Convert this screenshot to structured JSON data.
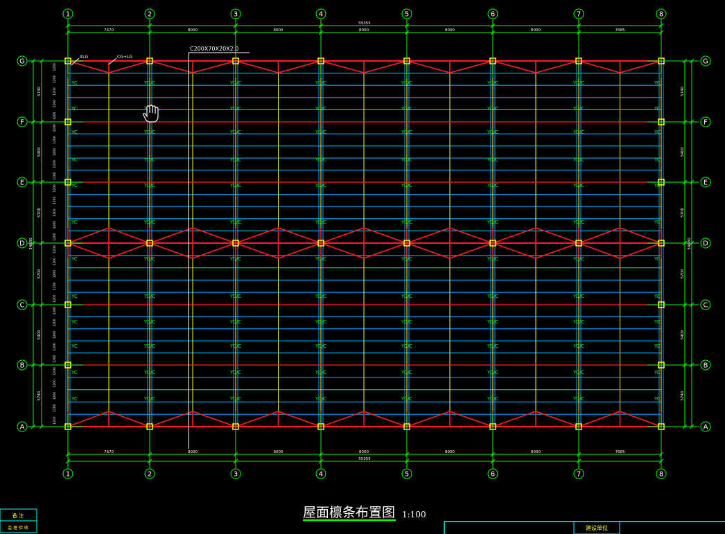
{
  "drawing": {
    "title": "屋面檩条布置图",
    "scale": "1:100",
    "section_callout": "C200X70X20X2.0",
    "callout_xlg": "XLG",
    "callout_cg": "CG+LG",
    "brace_label": "YC/C",
    "brace_label_short": "YC"
  },
  "grid": {
    "columns": [
      "1",
      "2",
      "3",
      "4",
      "5",
      "6",
      "7",
      "8"
    ],
    "rows": [
      "G",
      "F",
      "E",
      "D",
      "C",
      "B",
      "A"
    ]
  },
  "dimensions": {
    "top_bays": [
      "7670",
      "8000",
      "8000",
      "8000",
      "8000",
      "8000",
      "7685"
    ],
    "top_total": "55355",
    "bottom_bays": [
      "7670",
      "8000",
      "8000",
      "8000",
      "8000",
      "8000",
      "7685"
    ],
    "bottom_total": "55355",
    "left_spans": [
      "5740",
      "5400",
      "5700",
      "5700",
      "5400",
      "5740"
    ],
    "left_total": "34680",
    "right_spans": [
      "5740",
      "5400",
      "5700",
      "5700",
      "5400",
      "5740"
    ],
    "right_total": "34680",
    "purlin_spacing": "1200"
  },
  "title_block": {
    "left_line1": "备 注",
    "left_line2": "监 理 验 收",
    "right_label": "建设单位"
  },
  "colors": {
    "grid": "#00ff00",
    "purlin": "#00a2ff",
    "brace": "#ff2020",
    "column": "#ffff00",
    "text_white": "#ffffff",
    "title_block": "#00ffff"
  }
}
